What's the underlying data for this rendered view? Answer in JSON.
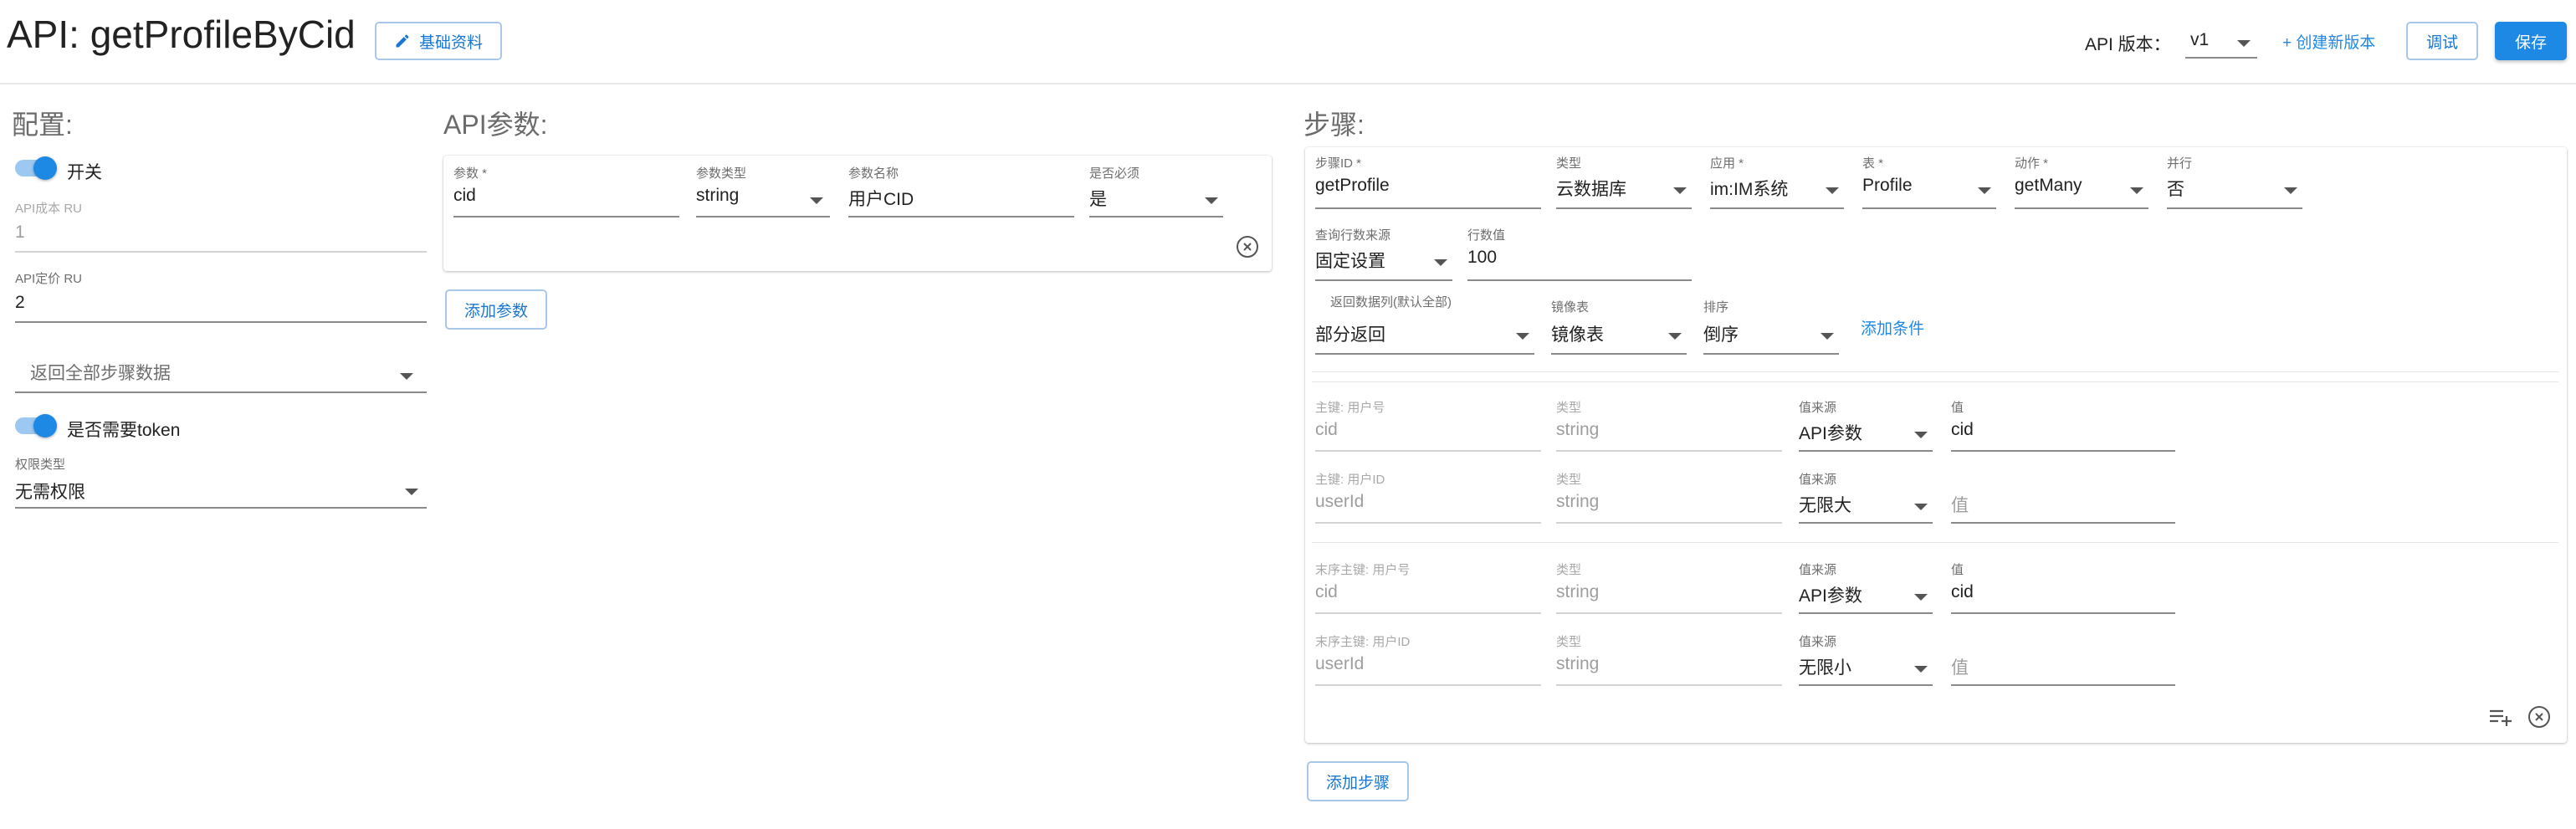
{
  "header": {
    "title": "API: getProfileByCid",
    "basic_info_button": "基础资料",
    "api_version_label": "API 版本：",
    "api_version_value": "v1",
    "create_version_link": "+ 创建新版本",
    "debug_button": "调试",
    "save_button": "保存"
  },
  "config": {
    "title": "配置:",
    "switch_label": "开关",
    "api_cost_label": "API成本 RU",
    "api_cost_value": "1",
    "api_price_label": "API定价 RU",
    "api_price_value": "2",
    "return_select": "返回全部步骤数据",
    "token_label": "是否需要token",
    "permission_label": "权限类型",
    "permission_value": "无需权限"
  },
  "api_params": {
    "title": "API参数:",
    "headers": {
      "param": "参数 *",
      "param_type": "参数类型",
      "param_name": "参数名称",
      "required": "是否必须"
    },
    "rows": [
      {
        "param": "cid",
        "param_type": "string",
        "param_name": "用户CID",
        "required": "是"
      }
    ],
    "add_button": "添加参数"
  },
  "steps": {
    "title": "步骤:",
    "step": {
      "labels": {
        "step_id": "步骤ID *",
        "type": "类型",
        "app": "应用 *",
        "table": "表 *",
        "action": "动作 *",
        "parallel": "并行",
        "row_source": "查询行数来源",
        "row_count": "行数值",
        "return_cols": "返回数据列(默认全部)",
        "mirror": "镜像表",
        "sort": "排序"
      },
      "values": {
        "step_id": "getProfile",
        "type": "云数据库",
        "app": "im:IM系统",
        "table": "Profile",
        "action": "getMany",
        "parallel": "否",
        "row_source": "固定设置",
        "row_count": "100",
        "return_cols": "部分返回",
        "mirror": "镜像表",
        "sort": "倒序"
      },
      "add_condition_link": "添加条件",
      "conditions": [
        {
          "key_label": "主键: 用户号",
          "key": "cid",
          "type_label": "类型",
          "type": "string",
          "source_label": "值来源",
          "source": "API参数",
          "value_label": "值",
          "value": "cid"
        },
        {
          "key_label": "主键: 用户ID",
          "key": "userId",
          "type_label": "类型",
          "type": "string",
          "source_label": "值来源",
          "source": "无限大",
          "value_label": "",
          "value": "值"
        },
        {
          "key_label": "末序主键: 用户号",
          "key": "cid",
          "type_label": "类型",
          "type": "string",
          "source_label": "值来源",
          "source": "API参数",
          "value_label": "值",
          "value": "cid"
        },
        {
          "key_label": "末序主键: 用户ID",
          "key": "userId",
          "type_label": "类型",
          "type": "string",
          "source_label": "值来源",
          "source": "无限小",
          "value_label": "",
          "value": "值"
        }
      ]
    },
    "add_button": "添加步骤"
  },
  "colors": {
    "primary": "#1e88e5",
    "toggle_track": "#9cc8f2",
    "title": "#222222",
    "muted": "#9e9e9e"
  }
}
